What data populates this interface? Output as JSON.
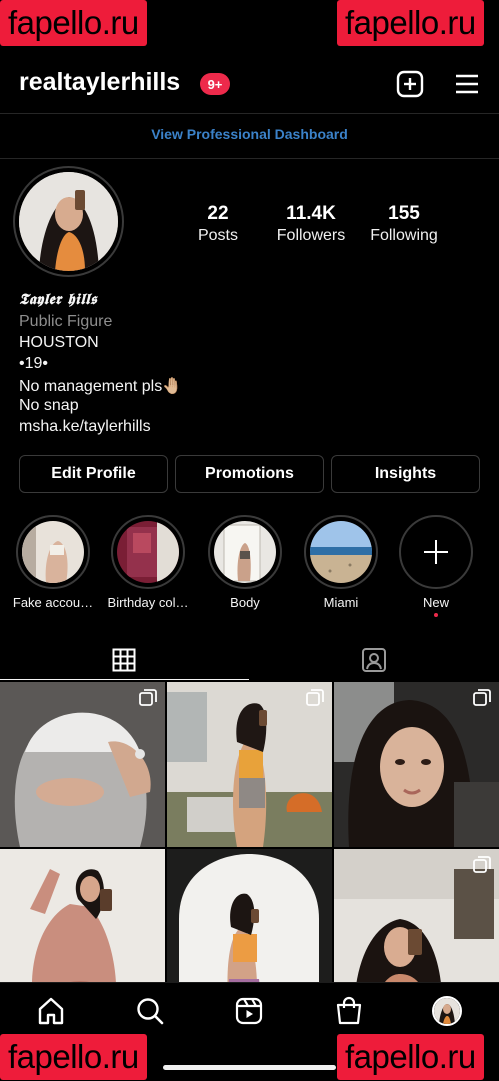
{
  "watermark": "fapello.ru",
  "header": {
    "username": "realtaylerhills",
    "notification_badge": "9+"
  },
  "professional_dashboard_label": "View Professional Dashboard",
  "profile": {
    "display_name": "𝕿𝖆𝖞𝖑𝖊𝖗 𝖍𝖎𝖑𝖑𝖘",
    "category": "Public Figure",
    "bio_lines": [
      "HOUSTON",
      "•19•",
      "No management pls🤚🏼",
      "No snap"
    ],
    "link": "msha.ke/taylerhills"
  },
  "stats": [
    {
      "value": "22",
      "label": "Posts"
    },
    {
      "value": "11.4K",
      "label": "Followers"
    },
    {
      "value": "155",
      "label": "Following"
    }
  ],
  "buttons": {
    "edit_profile": "Edit Profile",
    "promotions": "Promotions",
    "insights": "Insights"
  },
  "highlights": [
    {
      "label": "Fake accou…"
    },
    {
      "label": "Birthday col…"
    },
    {
      "label": "Body"
    },
    {
      "label": "Miami"
    },
    {
      "label": "New"
    }
  ],
  "colors": {
    "accent_link": "#3b82c9",
    "badge": "#ed2a4b",
    "watermark_bg": "#ee1c3a"
  }
}
